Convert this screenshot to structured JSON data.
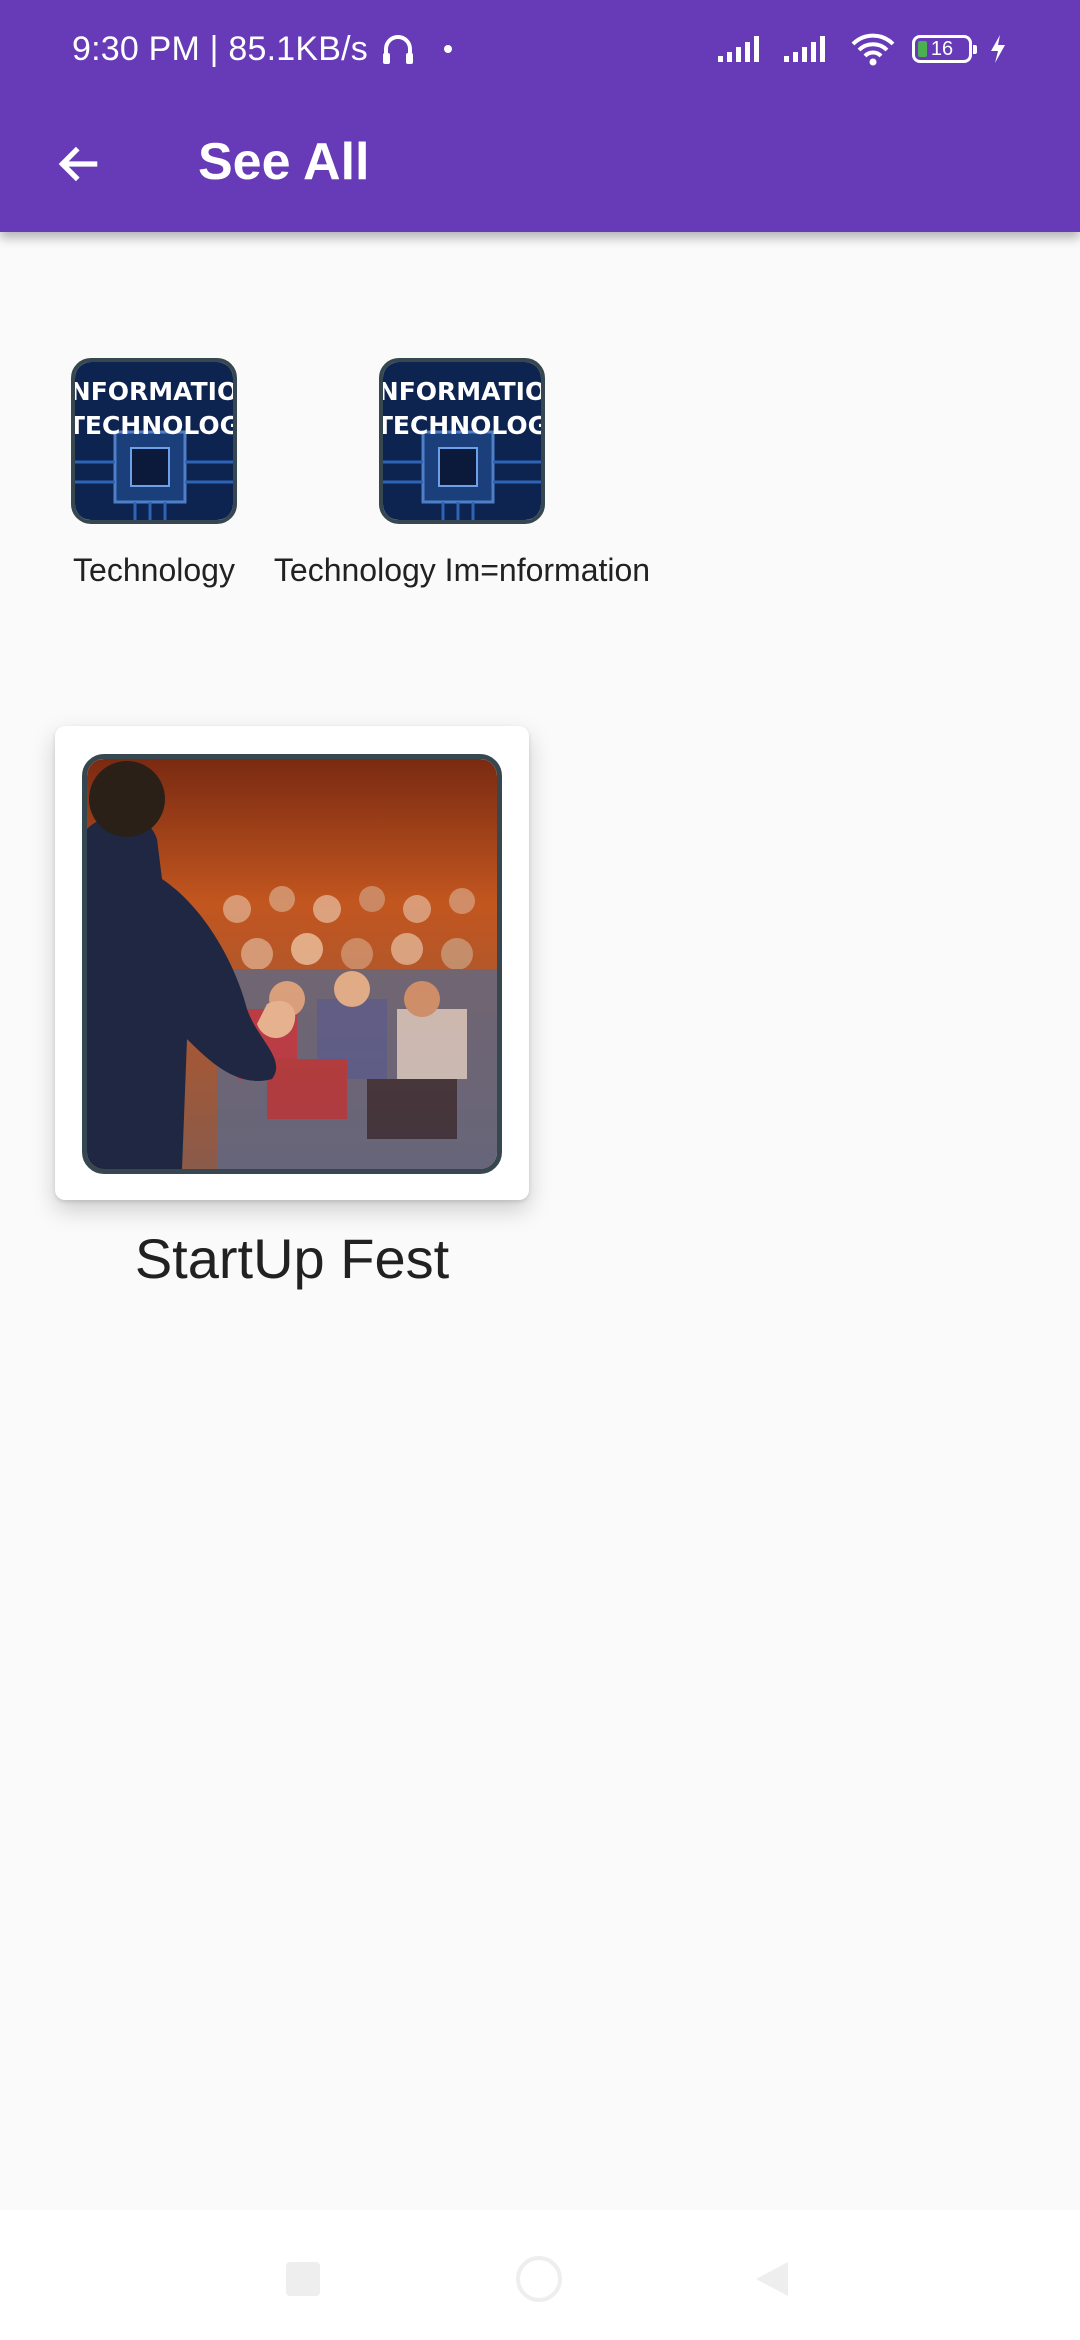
{
  "status_bar": {
    "time_speed": "9:30 PM | 85.1KB/s",
    "battery_level": "16",
    "icons": [
      "headphones-icon",
      "signal-icon",
      "signal-icon",
      "wifi-icon",
      "battery-icon",
      "charging-icon"
    ]
  },
  "app_bar": {
    "title": "See All",
    "back_icon": "arrow-back-icon",
    "color": "#673ab7"
  },
  "categories": [
    {
      "label": "Technology",
      "thumb_text": [
        "NFORMATIO",
        "TECHNOLOG"
      ]
    },
    {
      "label": "Technology Im=nformation",
      "thumb_text": [
        "NFORMATIO",
        "TECHNOLOG"
      ]
    }
  ],
  "events": [
    {
      "title": "StartUp Fest"
    }
  ],
  "nav_bar": {
    "buttons": [
      "recents-button",
      "home-button",
      "back-button"
    ]
  }
}
